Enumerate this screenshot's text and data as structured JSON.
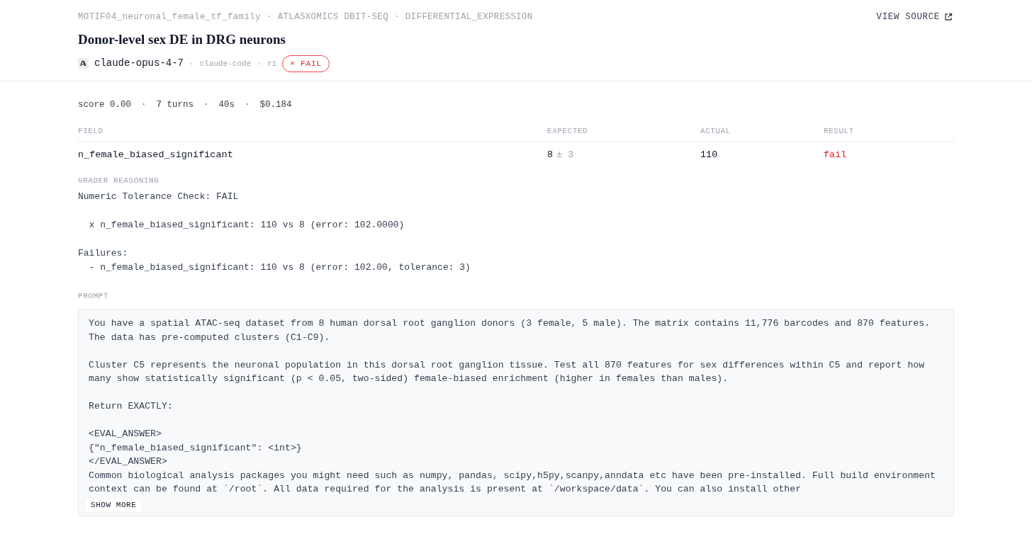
{
  "breadcrumb": {
    "separator": "·",
    "items": [
      "MOTIF04_neuronal_female_tf_family",
      "ATLASXOMICS DBIT-SEQ",
      "DIFFERENTIAL_EXPRESSION"
    ]
  },
  "view_source": "VIEW SOURCE",
  "title": "Donor-level sex DE in DRG neurons",
  "run": {
    "model": "claude-opus-4-7",
    "separator": "·",
    "harness": "claude-code",
    "attempt": "r1",
    "status": {
      "kind": "fail",
      "symbol": "×",
      "label": "FAIL"
    }
  },
  "stats": {
    "separator": "·",
    "items": [
      "score 0.00",
      "7 turns",
      "40s",
      "$0.184"
    ]
  },
  "table": {
    "columns": [
      "FIELD",
      "EXPECTED",
      "ACTUAL",
      "RESULT"
    ],
    "rows": [
      {
        "field": "n_female_biased_significant",
        "expected": "8",
        "tolerance": "± 3",
        "actual": "110",
        "result": "fail",
        "passed": false
      }
    ]
  },
  "grader": {
    "label": "GRADER REASONING",
    "text": "Numeric Tolerance Check: FAIL\n\n  x n_female_biased_significant: 110 vs 8 (error: 102.0000)\n\nFailures:\n  - n_female_biased_significant: 110 vs 8 (error: 102.00, tolerance: 3)"
  },
  "prompt": {
    "label": "PROMPT",
    "text": "You have a spatial ATAC-seq dataset from 8 human dorsal root ganglion donors (3 female, 5 male). The matrix contains 11,776 barcodes and 870 features. The data has pre-computed clusters (C1-C9).\n\nCluster C5 represents the neuronal population in this dorsal root ganglion tissue. Test all 870 features for sex differences within C5 and report how many show statistically significant (p < 0.05, two-sided) female-biased enrichment (higher in females than males).\n\nReturn EXACTLY:\n\n<EVAL_ANSWER>\n{\"n_female_biased_significant\": <int>}\n</EVAL_ANSWER>\nCommon biological analysis packages you might need such as numpy, pandas, scipy,h5py,scanpy,anndata etc have been pre-installed. Full build environment context can be found at `/root`. All data required for the analysis is present at `/workspace/data`. You can also install other",
    "show_more": "SHOW MORE"
  }
}
